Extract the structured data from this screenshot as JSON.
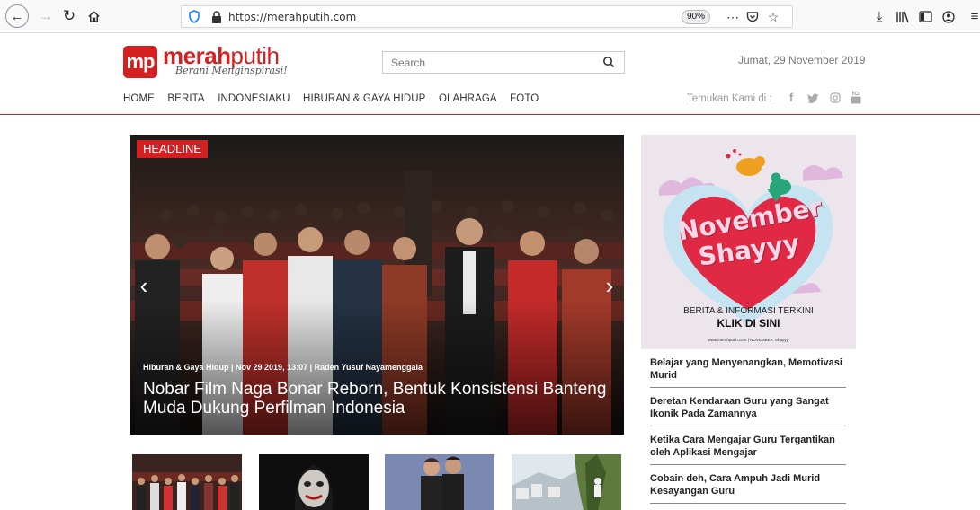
{
  "browser": {
    "url": "https://merahputih.com",
    "zoom": "90%"
  },
  "site": {
    "logo_initials": "mp",
    "logo_merah": "merah",
    "logo_putih": "putih",
    "tagline": "Berani Menginspirasi!",
    "search_placeholder": "Search",
    "date": "Jumat, 29 November 2019",
    "nav": [
      "HOME",
      "BERITA",
      "INDONESIAKU",
      "HIBURAN & GAYA HIDUP",
      "OLAHRAGA",
      "FOTO"
    ],
    "find_us": "Temukan Kami di :"
  },
  "headline": {
    "badge": "HEADLINE",
    "meta": "Hiburan & Gaya Hidup | Nov 29 2019, 13:07 | Raden Yusuf Nayamenggala",
    "title": "Nobar Film Naga Bonar Reborn, Bentuk Konsistensi Banteng Muda Dukung Perfilman Indonesia"
  },
  "ad": {
    "word1": "November",
    "word2": "Shayyy",
    "line1": "BERITA & INFORMASI TERKINI",
    "line2": "KLIK DI SINI",
    "footer": "www.merahputih.com | NOVEMBER 'Shayyy'"
  },
  "sidebar_news": [
    "Belajar yang Menyenangkan, Memotivasi Murid",
    "Deretan Kendaraan Guru yang Sangat Ikonik Pada Zamannya",
    "Ketika Cara Mengajar Guru Tergantikan oleh Aplikasi Mengajar",
    "Cobain deh, Cara Ampuh Jadi Murid Kesayangan Guru"
  ],
  "colors": {
    "brand_red": "#d42021"
  }
}
